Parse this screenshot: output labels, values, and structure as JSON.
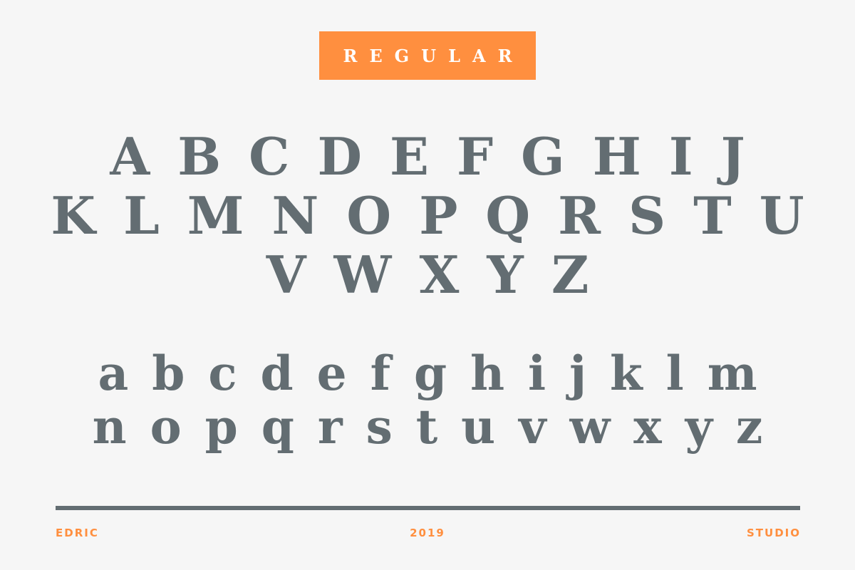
{
  "badge": {
    "label": "REGULAR"
  },
  "uppercase": {
    "row1": "A B C D E F G H I J",
    "row2": "K L M N O P Q R S T U",
    "row3": "V W X Y Z"
  },
  "lowercase": {
    "row1": "a b c d e f g h i j k l m",
    "row2": "n o p q r s t u v w x y z"
  },
  "footer": {
    "left": "EDRIC",
    "center": "2019",
    "right": "STUDIO"
  },
  "colors": {
    "accent": "#ff8f3f",
    "glyph": "#636d72",
    "background": "#f6f6f6"
  }
}
